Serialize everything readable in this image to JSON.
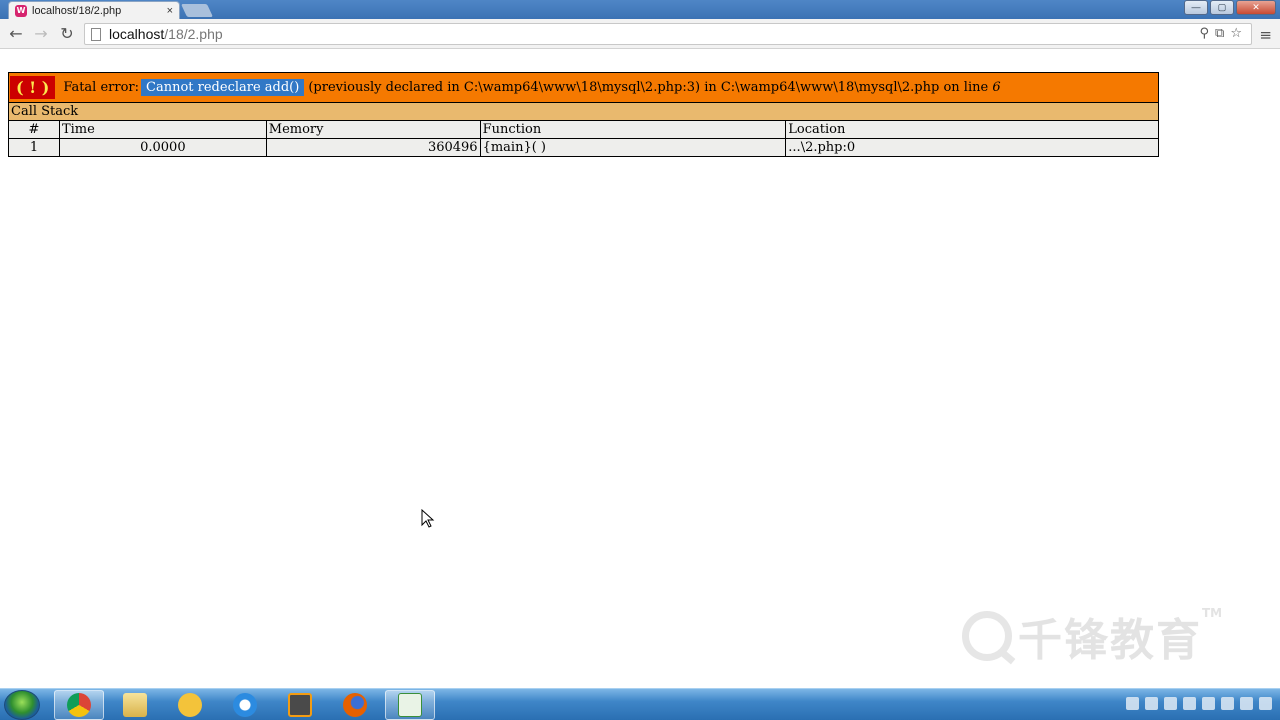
{
  "browser": {
    "tab_title": "localhost/18/2.php",
    "tab_close": "×",
    "url_host": "localhost",
    "url_path": "/18/2.php",
    "win_minimize": "—",
    "win_maximize": "▢",
    "win_close": "✕"
  },
  "error": {
    "bang": "( ! )",
    "label": "Fatal error:",
    "message": "Cannot redeclare add()",
    "detail": "(previously declared in C:\\wamp64\\www\\18\\mysql\\2.php:3) in C:\\wamp64\\www\\18\\mysql\\2.php on line",
    "line": "6"
  },
  "call_stack": {
    "title": "Call Stack",
    "columns": [
      "#",
      "Time",
      "Memory",
      "Function",
      "Location"
    ],
    "rows": [
      {
        "num": "1",
        "time": "0.0000",
        "memory": "360496",
        "function": "{main}( )",
        "location": "...\\2.php:0"
      }
    ]
  },
  "watermark": {
    "text": "千锋教育",
    "tm": "TM"
  },
  "colors": {
    "error_header": "#f57900",
    "bang_bg": "#cc0000",
    "highlight": "#3178c6",
    "callstack_bg": "#e9b96e",
    "cell_bg": "#eeeeec"
  },
  "taskbar": {
    "items": [
      "chrome-icon",
      "file-explorer-icon",
      "app-icon",
      "internet-explorer-icon",
      "sublime-text-icon",
      "firefox-icon",
      "chart-app-icon"
    ]
  }
}
